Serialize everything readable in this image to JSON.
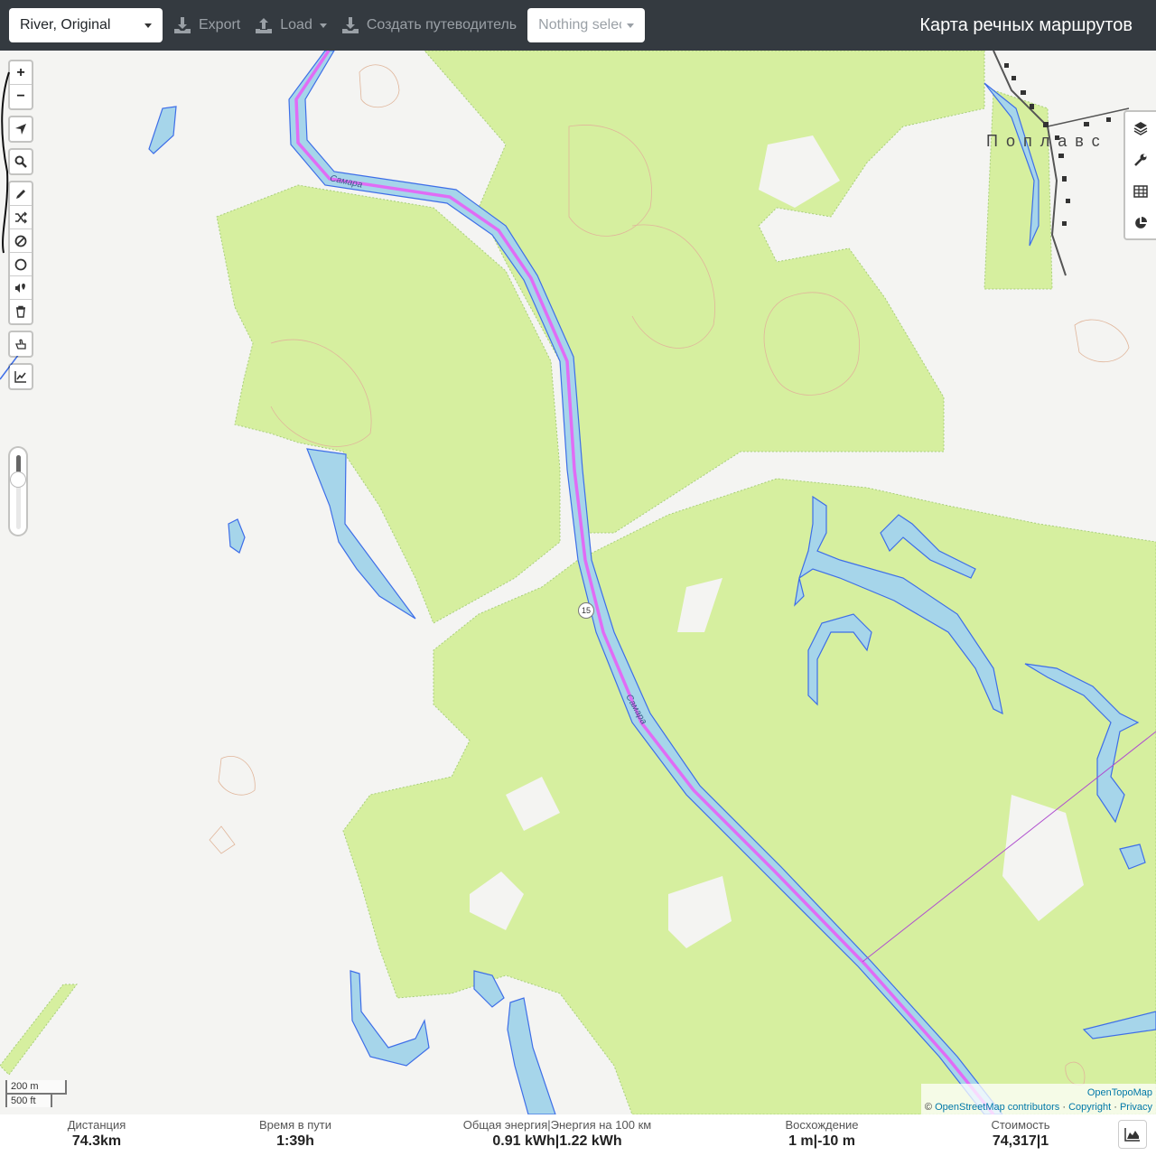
{
  "topbar": {
    "profile": "River, Original",
    "export_label": "Export",
    "load_label": "Load",
    "guide_label": "Создать путеводитель",
    "selection_placeholder": "Nothing selected",
    "title": "Карта речных маршрутов"
  },
  "map": {
    "place_name": "Поплавс",
    "river_labels": [
      "Самара",
      "Самара"
    ],
    "route_number": "15"
  },
  "left_toolbar": {
    "zoom_in": "+",
    "zoom_out": "−",
    "icons": [
      "locate-icon",
      "search-icon",
      "pencil-icon",
      "shuffle-icon",
      "no-entry-icon",
      "circle-icon",
      "pin-audio-icon",
      "trash-icon",
      "hand-pointer-icon",
      "chart-line-icon"
    ]
  },
  "right_panel": {
    "icons": [
      "layers-icon",
      "wrench-icon",
      "table-icon",
      "pie-chart-icon"
    ]
  },
  "scale": {
    "metric": "200 m",
    "imperial": "500 ft"
  },
  "attribution": {
    "line1": "OpenTopoMap",
    "prefix": "©",
    "osm": "OpenStreetMap contributors",
    "sep": "·",
    "copyright": "Copyright",
    "privacy": "Privacy"
  },
  "stats": {
    "distance": {
      "label": "Дистанция",
      "value": "74.3",
      "unit": "km"
    },
    "time": {
      "label": "Время в пути",
      "value": "1:39",
      "unit": "h"
    },
    "energy": {
      "label": "Общая энергия|Энергия на 100 км",
      "value": "0.91 kWh|1.22 kWh"
    },
    "ascent": {
      "label": "Восхождение",
      "value": "1 m|-10 m"
    },
    "cost": {
      "label": "Стоимость",
      "value": "74,317|1"
    }
  },
  "colors": {
    "topbar": "#343a40",
    "forest": "#d6ef9f",
    "water": "#a6d5ea",
    "route": "#e06cf5"
  }
}
